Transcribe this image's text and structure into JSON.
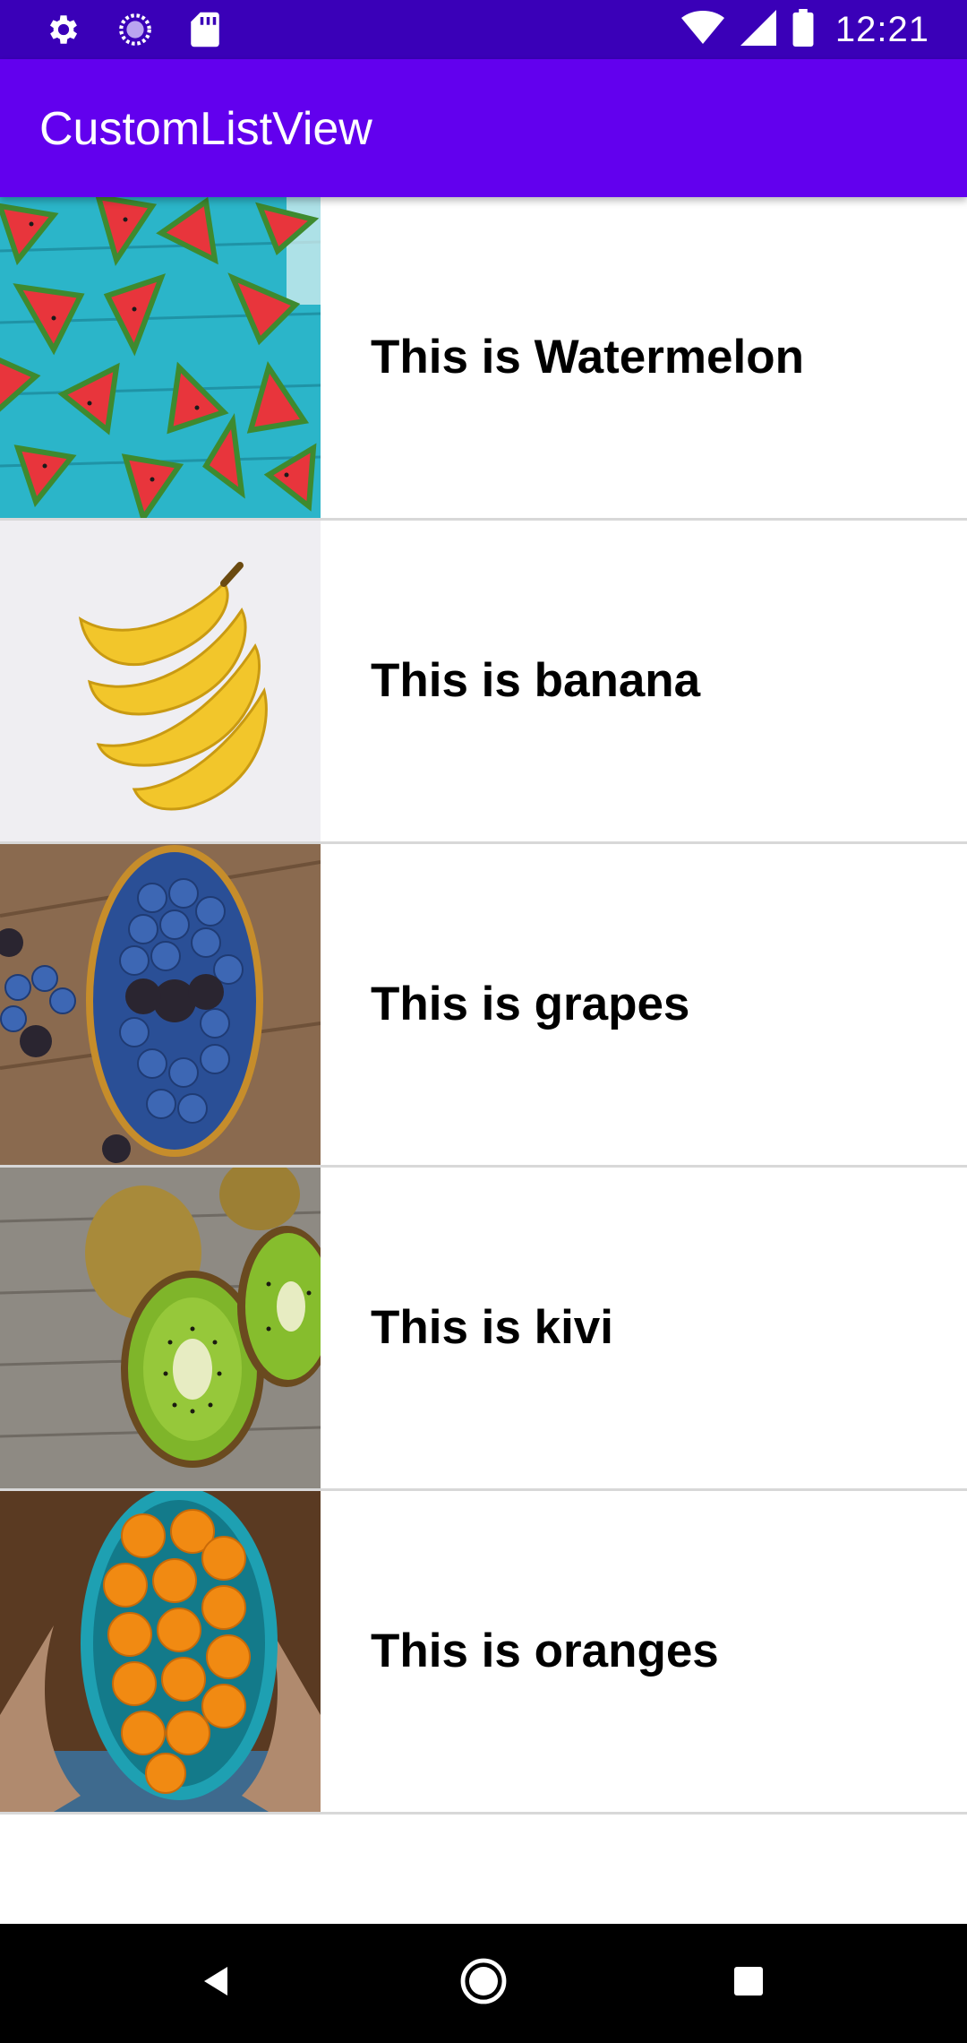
{
  "status_bar": {
    "time": "12:21",
    "icons": [
      "settings-icon",
      "sync-icon",
      "sd-card-icon",
      "wifi-icon",
      "signal-icon",
      "battery-icon"
    ]
  },
  "app_bar": {
    "title": "CustomListView",
    "color": "#6200ee",
    "status_color": "#3a00b8"
  },
  "list": {
    "items": [
      {
        "label": "This is Watermelon",
        "image": "watermelon-image"
      },
      {
        "label": "This is banana",
        "image": "banana-image"
      },
      {
        "label": "This is grapes",
        "image": "grapes-image"
      },
      {
        "label": "This is kivi",
        "image": "kiwi-image"
      },
      {
        "label": "This is oranges",
        "image": "oranges-image"
      }
    ]
  },
  "nav_bar": {
    "buttons": [
      "back-icon",
      "home-icon",
      "recents-icon"
    ]
  }
}
